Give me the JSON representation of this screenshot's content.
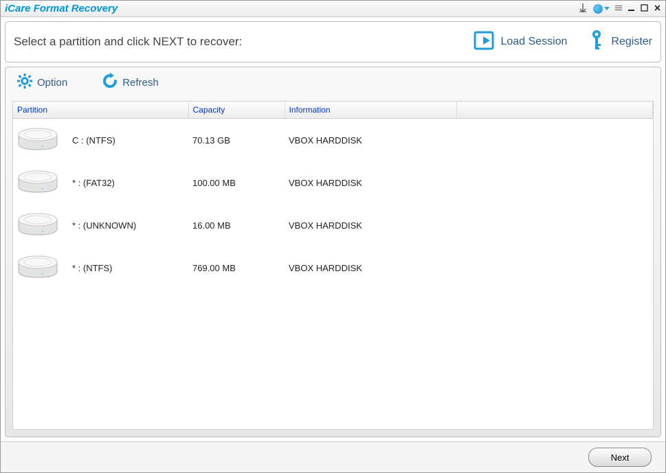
{
  "app_title": "iCare Format Recovery",
  "header": {
    "instruction": "Select a partition and click NEXT to recover:",
    "load_session": "Load Session",
    "register": "Register"
  },
  "toolbar": {
    "option": "Option",
    "refresh": "Refresh"
  },
  "columns": {
    "partition": "Partition",
    "capacity": "Capacity",
    "information": "Information"
  },
  "rows": [
    {
      "partition": "C :  (NTFS)",
      "capacity": "70.13 GB",
      "information": "VBOX HARDDISK"
    },
    {
      "partition": "* :  (FAT32)",
      "capacity": "100.00 MB",
      "information": "VBOX HARDDISK"
    },
    {
      "partition": "* :  (UNKNOWN)",
      "capacity": "16.00 MB",
      "information": "VBOX HARDDISK"
    },
    {
      "partition": "* :  (NTFS)",
      "capacity": "769.00 MB",
      "information": "VBOX HARDDISK"
    }
  ],
  "footer": {
    "next": "Next"
  }
}
